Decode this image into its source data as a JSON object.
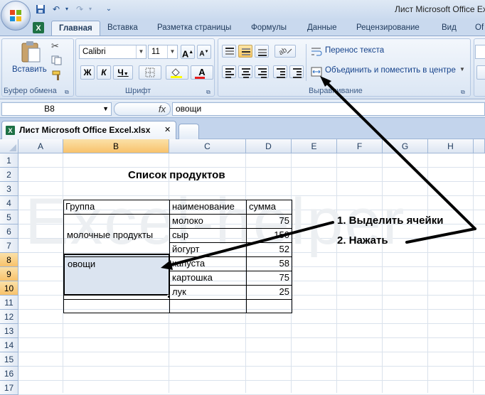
{
  "window": {
    "title": "Лист Microsoft Office Excel"
  },
  "ribbon_tabs": [
    "Главная",
    "Вставка",
    "Разметка страницы",
    "Формулы",
    "Данные",
    "Рецензирование",
    "Вид",
    "Of"
  ],
  "clipboard": {
    "paste_label": "Вставить",
    "group_label": "Буфер обмена"
  },
  "font": {
    "name": "Calibri",
    "size": "11",
    "bold": "Ж",
    "italic": "К",
    "underline": "Ч",
    "font_color_glyph": "A",
    "grow_glyph": "A",
    "shrink_glyph": "A",
    "group_label": "Шрифт"
  },
  "alignment": {
    "wrap_text": "Перенос текста",
    "merge_center": "Объединить и поместить в центре",
    "group_label": "Выравнивание"
  },
  "formula_bar": {
    "name_box": "B8",
    "fx": "fx",
    "value": "овощи"
  },
  "document": {
    "tab_label": "Лист Microsoft Office Excel.xlsx",
    "close_glyph": "✕"
  },
  "sheet": {
    "columns": [
      "A",
      "B",
      "C",
      "D",
      "E",
      "F",
      "G",
      "H"
    ],
    "rows": [
      "1",
      "2",
      "3",
      "4",
      "5",
      "6",
      "7",
      "8",
      "9",
      "10",
      "11",
      "12",
      "13",
      "14",
      "15",
      "16",
      "17"
    ],
    "selected_cell": "B8",
    "title": "Список продуктов",
    "headers": {
      "group": "Группа",
      "name": "наименование",
      "sum": "сумма"
    },
    "items": [
      {
        "name": "молоко",
        "sum": "75"
      },
      {
        "name": "сыр",
        "sum": "150"
      },
      {
        "name": "йогурт",
        "sum": "52"
      },
      {
        "name": "капуста",
        "sum": "58"
      },
      {
        "name": "картошка",
        "sum": "75"
      },
      {
        "name": "лук",
        "sum": "25"
      }
    ],
    "groups": {
      "dairy": "молочные продукты",
      "veg": "овощи"
    }
  },
  "watermark": "Excel-helper",
  "annotations": {
    "step1": "1. Выделить ячейки",
    "step2": "2. Нажать"
  },
  "colors": {
    "ribbon": "#d6e2f1",
    "selection_header": "#f8c26b",
    "annotation": "#000000"
  }
}
